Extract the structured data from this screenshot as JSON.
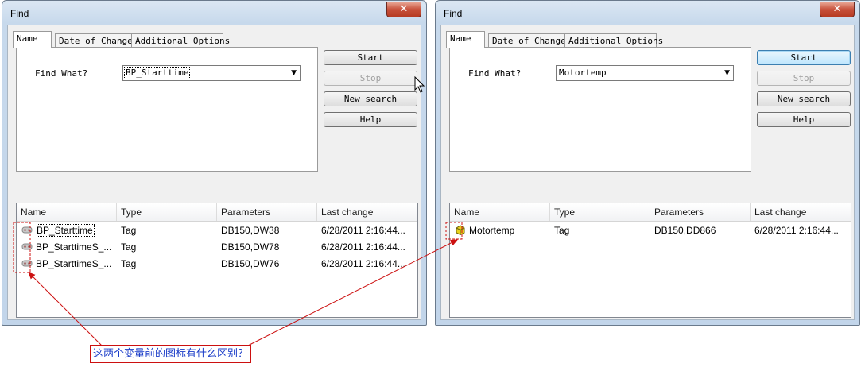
{
  "left_window": {
    "title": "Find",
    "close_glyph": "✕",
    "tabs": [
      {
        "label": "Name",
        "selected": true
      },
      {
        "label": "Date of Change",
        "selected": false
      },
      {
        "label": "Additional Options",
        "selected": false
      }
    ],
    "find_label": "Find What?",
    "find_value": "BP_Starttime",
    "buttons": {
      "start": "Start",
      "stop": "Stop",
      "new_search": "New search",
      "help": "Help"
    },
    "columns": [
      "Name",
      "Type",
      "Parameters",
      "Last change"
    ],
    "rows": [
      {
        "name": "BP_Starttime",
        "type": "Tag",
        "parameters": "DB150,DW38",
        "last_change": "6/28/2011 2:16:44..."
      },
      {
        "name": "BP_StarttimeS_...",
        "type": "Tag",
        "parameters": "DB150,DW78",
        "last_change": "6/28/2011 2:16:44..."
      },
      {
        "name": "BP_StarttimeS_...",
        "type": "Tag",
        "parameters": "DB150,DW76",
        "last_change": "6/28/2011 2:16:44..."
      }
    ],
    "row_icon": "grey-tag-icon"
  },
  "right_window": {
    "title": "Find",
    "close_glyph": "✕",
    "tabs": [
      {
        "label": "Name",
        "selected": true
      },
      {
        "label": "Date of Change",
        "selected": false
      },
      {
        "label": "Additional Options",
        "selected": false
      }
    ],
    "find_label": "Find What?",
    "find_value": "Motortemp",
    "buttons": {
      "start": "Start",
      "stop": "Stop",
      "new_search": "New search",
      "help": "Help"
    },
    "columns": [
      "Name",
      "Type",
      "Parameters",
      "Last change"
    ],
    "rows": [
      {
        "name": "Motortemp",
        "type": "Tag",
        "parameters": "DB150,DD866",
        "last_change": "6/28/2011 2:16:44..."
      }
    ],
    "row_icon": "yellow-cube-tag-icon"
  },
  "annotation": {
    "text": "这两个变量前的图标有什么区别？",
    "color": "#cc1010"
  },
  "dropdown_glyph": "▼",
  "colors": {
    "window_frame": "#c2d5ea",
    "close_button": "#c7503a",
    "default_button": "#bee6fd",
    "annotation_text": "#1a3cc8"
  }
}
